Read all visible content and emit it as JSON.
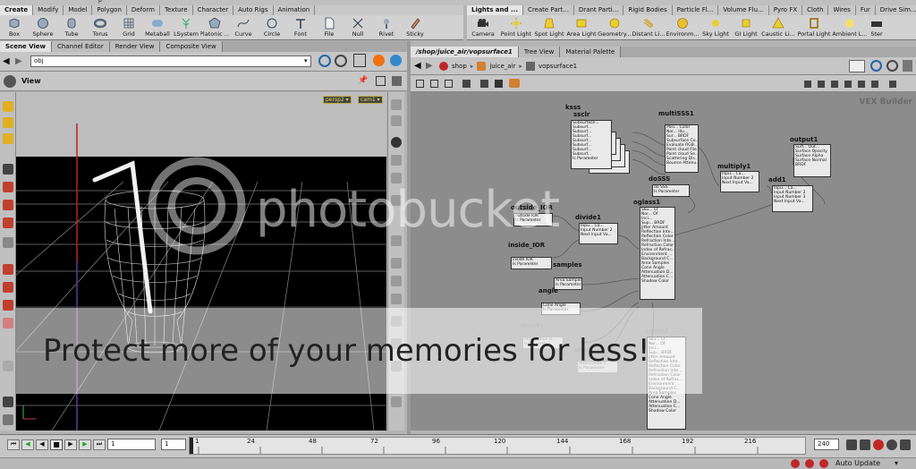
{
  "app": {
    "top_menu_partial": "p"
  },
  "shelf_left": {
    "tabs": [
      "Create",
      "Modify",
      "Model",
      "Polygon",
      "Deform",
      "Texture",
      "Character",
      "Auto Rigs",
      "Animation"
    ],
    "tools": [
      "Box",
      "Sphere",
      "Tube",
      "Torus",
      "Grid",
      "Metaball",
      "LSystem",
      "Platonic ...",
      "Curve",
      "Circle",
      "Font",
      "File",
      "Null",
      "Rivet",
      "Sticky"
    ]
  },
  "shelf_right": {
    "tabs": [
      "Lights and ...",
      "Create Part...",
      "Drant Parti...",
      "Rigid Bodies",
      "Particle Fl...",
      "Volume Flu...",
      "Pyro FX",
      "Cloth",
      "Wires",
      "Fur",
      "Drive Sim..."
    ],
    "tools": [
      "Camera",
      "Point Light",
      "Spot Light",
      "Area Light",
      "Geometry...",
      "Distant Li...",
      "Environm...",
      "Sky Light",
      "GI Light",
      "Caustic Li...",
      "Portal Light",
      "Ambient L...",
      "Ster"
    ]
  },
  "left_pane": {
    "tabs": [
      "Scene View",
      "Channel Editor",
      "Render View",
      "Composite View"
    ],
    "path": "obj",
    "view_label": "View",
    "camera_buttons": [
      "persp2 ▾",
      "cam1 ▾"
    ]
  },
  "right_pane": {
    "tabs": [
      "/shop/juice_air/vopsurface1",
      "Tree View",
      "Material Palette"
    ],
    "breadcrumb": [
      "shop",
      "juice_air",
      "vopsurface1"
    ],
    "builder_label": "VEX Builder"
  },
  "network_nodes": {
    "ksss": {
      "name": "ksss",
      "rows": [
        "Subsurface...",
        "Subsurf...",
        "Subsurf...",
        "Subsurf...",
        "Subsurf...",
        "Subsurf...",
        "Subsurf...",
        "Subsurf...",
        "Is Parameter"
      ]
    },
    "ssclr": {
      "name": "ssclr"
    },
    "multisss1": {
      "name": "multiSSS1",
      "rows": [
        "Posi...  Color",
        "Nor...  Illu...",
        "Sur...   BRDF",
        "Subsurface Co...",
        "Evaluate RGB...",
        "Point cloud File",
        "Point cloud Se...",
        "Scattering Dis...",
        "Bounce Attenu..."
      ]
    },
    "multiply1": {
      "name": "multiply1",
      "rows": [
        "Inpu...  Ca...",
        "Input Number 2",
        "Next Input Va..."
      ]
    },
    "output1": {
      "name": "output1",
      "rows": [
        "Surf...  Out...",
        "Surface Opacity",
        "Surface Alpha",
        "Surface Normal",
        "BRDF"
      ]
    },
    "dosss": {
      "name": "doSSS",
      "rows": [
        "do SSS",
        "Is Parameter"
      ]
    },
    "add1": {
      "name": "add1",
      "rows": [
        "Inpu...  Ca...",
        "Input Number 2",
        "Input Number 3",
        "Next Input Va..."
      ]
    },
    "outside_ior": {
      "name": "outside_IOR",
      "rows": [
        "outside IOR",
        "Is Parameter"
      ]
    },
    "divide1": {
      "name": "divide1",
      "rows": [
        "Inpu...  Ca...",
        "Input Number 2",
        "Next Input Va..."
      ]
    },
    "oglass1": {
      "name": "oglass1",
      "rows": [
        "Sku...  Cf",
        "Nor...  Of",
        "Inci...",
        "Sup...   BRDF",
        "Jitter Amount",
        "Reflection Inte...",
        "Reflection Color",
        "Refraction Inte...",
        "Refraction Color",
        "Index of Refrac...",
        "Environment ...",
        "Background C...",
        "Area Samples",
        "Cone Angle",
        "Attenuation D...",
        "Attenuation C...",
        "Shadow Color"
      ]
    },
    "inside_ior": {
      "name": "inside_IOR",
      "rows": [
        "inside IOR",
        "Is Parameter"
      ]
    },
    "samples": {
      "name": "samples",
      "rows": [
        "Area Samples",
        "Is Parameter"
      ]
    },
    "angle": {
      "name": "angle",
      "rows": [
        "Cone Angle",
        "Is Parameter"
      ]
    },
    "density": {
      "name": "density",
      "rows": [
        "Attenuation D...",
        "Is Parameter"
      ]
    },
    "atten": {
      "name": "atten",
      "rows": [
        "Attenuation C...",
        "Is Parameter"
      ]
    },
    "oglass2": {
      "name": "oglass2",
      "rows": [
        "Sku...  Cf",
        "Nor...  Of",
        "Inci...",
        "Sup...   BRDF",
        "Jitter Amount",
        "Reflection Inte...",
        "Reflection Color",
        "Refraction Inte...",
        "Refraction Color",
        "Index of Refrac...",
        "Environment ...",
        "Background C...",
        "Area Samples",
        "Cone Angle",
        "Attenuation D...",
        "Attenuation C...",
        "Shadow Color"
      ]
    }
  },
  "timeline": {
    "current_frame": "1",
    "start_frame": "1",
    "end_frame": "240",
    "ticks": [
      "1",
      "24",
      "48",
      "72",
      "96",
      "120",
      "144",
      "168",
      "192",
      "216"
    ]
  },
  "statusbar": {
    "auto_update": "Auto Update"
  },
  "watermark": {
    "logo": "photobucket",
    "banner": "Protect more of your memories for less!"
  },
  "colors": {
    "viewport_bg": "#000000",
    "network_bg": "#8c8c8c",
    "grid_line": "#7a7a7a",
    "axis_red": "#c02020",
    "camera_label": "#e0d050",
    "accent_red": "#c02828"
  }
}
